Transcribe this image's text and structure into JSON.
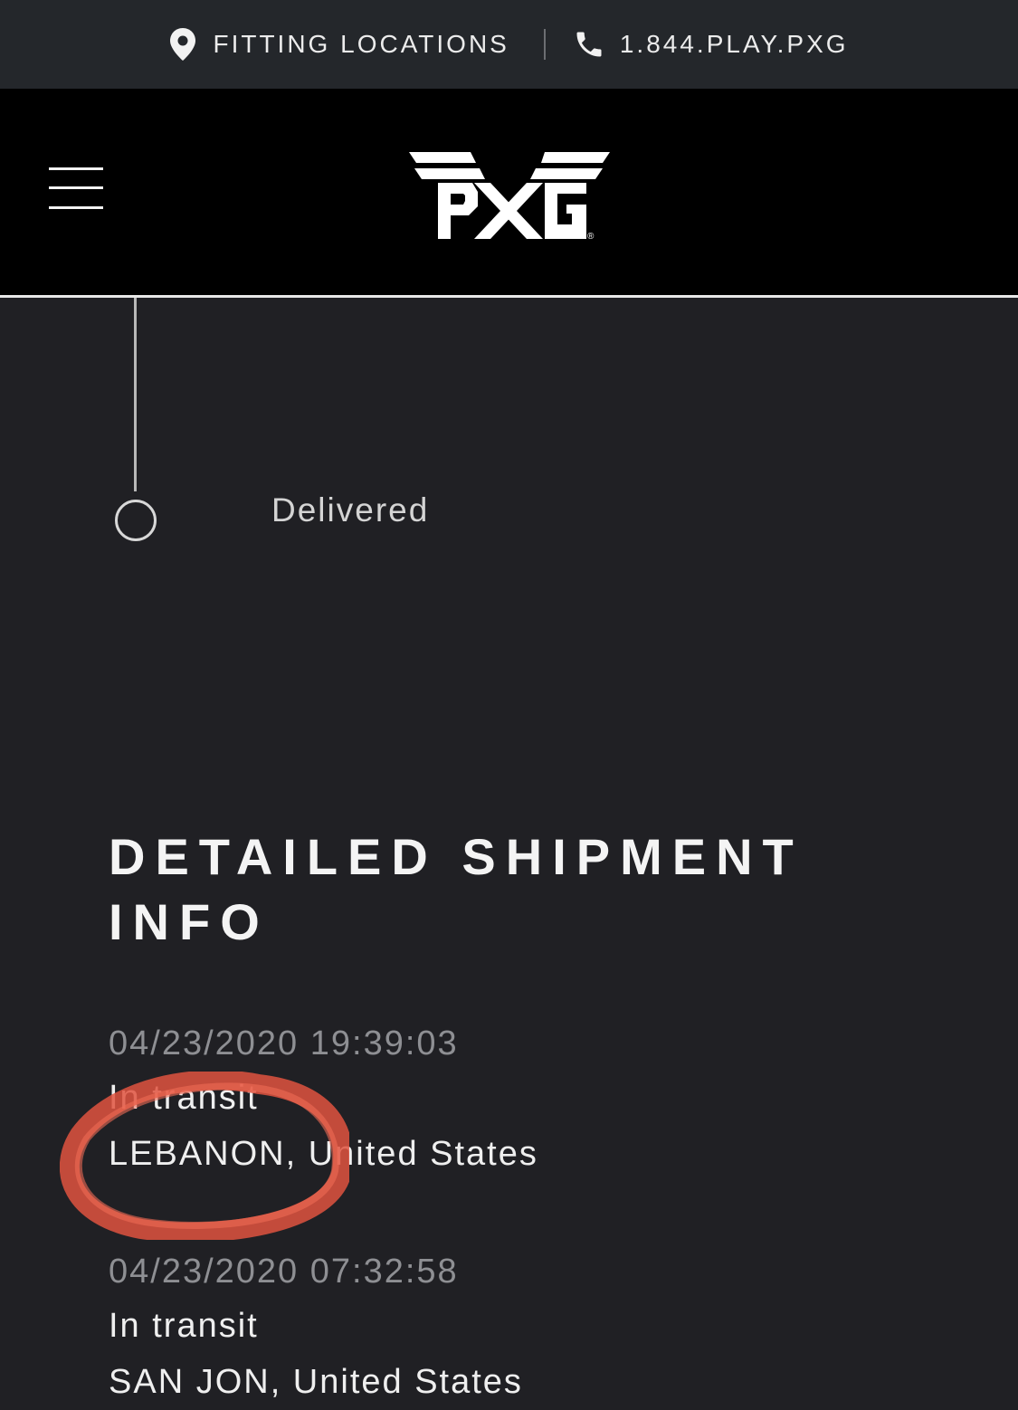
{
  "topbar": {
    "fitting_label": "FITTING LOCATIONS",
    "phone_label": "1.844.PLAY.PXG"
  },
  "navbar": {
    "logo_text": "PXG",
    "logo_mark": "®"
  },
  "tracking": {
    "status_label": "Delivered"
  },
  "shipment": {
    "title": "DETAILED SHIPMENT INFO",
    "events": [
      {
        "datetime": "04/23/2020 19:39:03",
        "status": "In transit",
        "location": "LEBANON, United States"
      },
      {
        "datetime": "04/23/2020 07:32:58",
        "status": "In transit",
        "location": "SAN JON, United States"
      }
    ]
  },
  "colors": {
    "page_bg": "#202024",
    "topbar_bg": "#24272b",
    "navbar_bg": "#000000",
    "highlight": "#e0533f"
  },
  "icons": [
    "location-pin-icon",
    "phone-icon",
    "hamburger-menu-icon",
    "pxg-logo"
  ]
}
